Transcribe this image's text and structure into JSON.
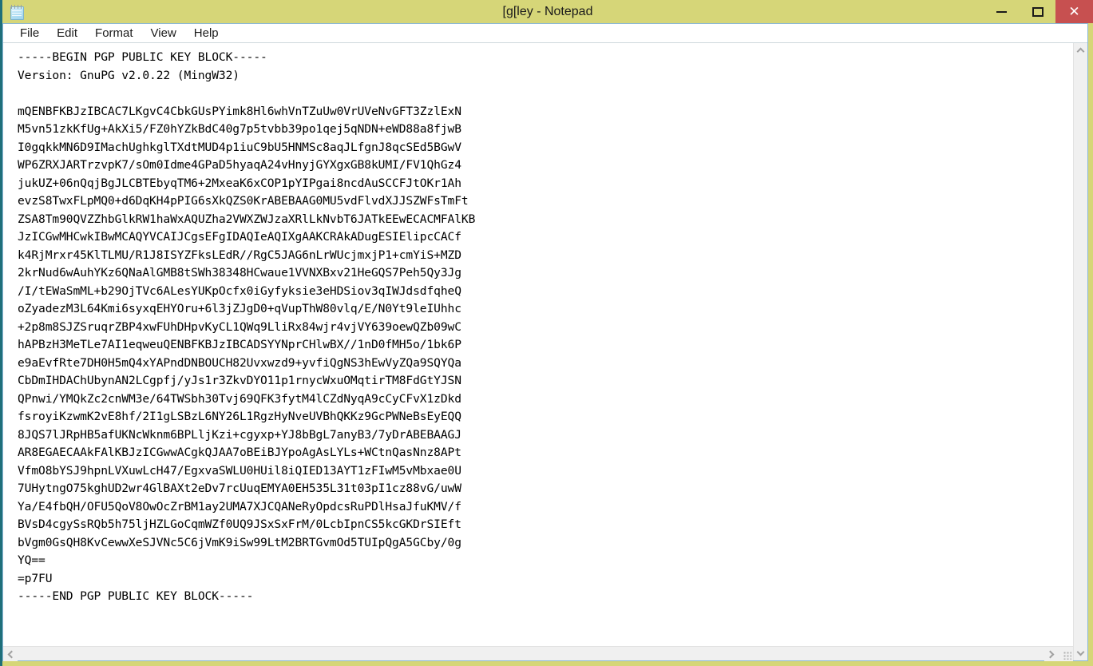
{
  "window": {
    "title": "[g[ley - Notepad",
    "app_icon": "notepad-icon",
    "titlebar_color": "#d6d678",
    "close_button_color": "#c75050",
    "border_color": "#1f6f7a"
  },
  "controls": {
    "minimize_label": "",
    "maximize_label": "",
    "close_label": "✕"
  },
  "menubar": {
    "items": [
      {
        "label": "File"
      },
      {
        "label": "Edit"
      },
      {
        "label": "Format"
      },
      {
        "label": "View"
      },
      {
        "label": "Help"
      }
    ]
  },
  "editor": {
    "content": "-----BEGIN PGP PUBLIC KEY BLOCK-----\nVersion: GnuPG v2.0.22 (MingW32)\n\nmQENBFKBJzIBCAC7LKgvC4CbkGUsPYimk8Hl6whVnTZuUw0VrUVeNvGFT3ZzlExN\nM5vn51zkKfUg+AkXi5/FZ0hYZkBdC40g7p5tvbb39po1qej5qNDN+eWD88a8fjwB\nI0gqkkMN6D9IMachUghkglTXdtMUD4p1iuC9bU5HNMSc8aqJLfgnJ8qcSEd5BGwV\nWP6ZRXJARTrzvpK7/sOm0Idme4GPaD5hyaqA24vHnyjGYXgxGB8kUMI/FV1QhGz4\njukUZ+06nQqjBgJLCBTEbyqTM6+2MxeaK6xCOP1pYIPgai8ncdAuSCCFJtOKr1Ah\nevzS8TwxFLpMQ0+d6DqKH4pPIG6sXkQZS0KrABEBAAG0MU5vdFlvdXJJSZWFsTmFt\nZSA8Tm90QVZZhbGlkRW1haWxAQUZha2VWXZWJzaXRlLkNvbT6JATkEEwECACMFAlKB\nJzICGwMHCwkIBwMCAQYVCAIJCgsEFgIDAQIeAQIXgAAKCRAkADugESIElipcCACf\nk4RjMrxr45KlTLMU/R1J8ISYZFksLEdR//RgC5JAG6nLrWUcjmxjP1+cmYiS+MZD\n2krNud6wAuhYKz6QNaAlGMB8tSWh38348HCwaue1VVNXBxv21HeGQS7Peh5Qy3Jg\n/I/tEWaSmML+b29OjTVc6ALesYUKpOcfx0iGyfyksie3eHDSiov3qIWJdsdfqheQ\noZyadezM3L64Kmi6syxqEHYOru+6l3jZJgD0+qVupThW80vlq/E/N0Yt9leIUhhc\n+2p8m8SJZSruqrZBP4xwFUhDHpvKyCL1QWq9LliRx84wjr4vjVY639oewQZb09wC\nhAPBzH3MeTLe7AI1eqweuQENBFKBJzIBCADSYYNprCHlwBX//1nD0fMH5o/1bk6P\ne9aEvfRte7DH0H5mQ4xYAPndDNBOUCH82Uvxwzd9+yvfiQgNS3hEwVyZQa9SQYQa\nCbDmIHDAChUbynAN2LCgpfj/yJs1r3ZkvDYO11p1rnycWxuOMqtirTM8FdGtYJSN\nQPnwi/YMQkZc2cnWM3e/64TWSbh30Tvj69QFK3fytM4lCZdNyqA9cCyCFvX1zDkd\nfsroyiKzwmK2vE8hf/2I1gLSBzL6NY26L1RgzHyNveUVBhQKKz9GcPWNeBsEyEQQ\n8JQS7lJRpHB5afUKNcWknm6BPLljKzi+cgyxp+YJ8bBgL7anyB3/7yDrABEBAAGJ\nAR8EGAECAAkFAlKBJzICGwwACgkQJAA7oBEiBJYpoAgAsLYLs+WCtnQasNnz8APt\nVfmO8bYSJ9hpnLVXuwLcH47/EgxvaSWLU0HUil8iQIED13AYT1zFIwM5vMbxae0U\n7UHytngO75kghUD2wr4GlBAXt2eDv7rcUuqEMYA0EH535L31t03pI1cz88vG/uwW\nYa/E4fbQH/OFU5QoV8OwOcZrBM1ay2UMA7XJCQANeRyOpdcsRuPDlHsaJfuKMV/f\nBVsD4cgySsRQb5h75ljHZLGoCqmWZf0UQ9JSxSxFrM/0LcbIpnCS5kcGKDrSIEft\nbVgm0GsQH8KvCewwXeSJVNc5C6jVmK9iSw99LtM2BRTGvmOd5TUIpQgA5GCby/0g\nYQ==\n=p7FU\n-----END PGP PUBLIC KEY BLOCK-----"
  },
  "scrollbars": {
    "vertical": {
      "up_arrow": "chevron-up",
      "down_arrow": "chevron-down"
    },
    "horizontal": {
      "left_arrow": "chevron-left",
      "right_arrow": "chevron-right"
    },
    "resize_grip": "resize-grip"
  }
}
